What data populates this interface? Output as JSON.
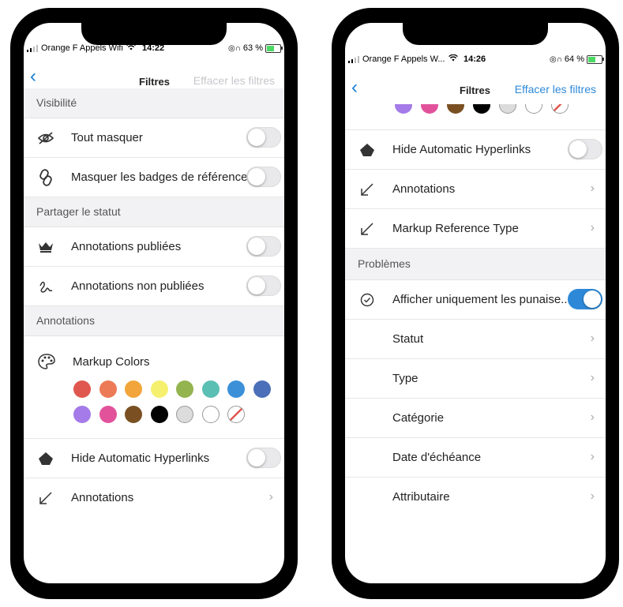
{
  "left": {
    "status": {
      "carrier": "Orange F Appels Wifi",
      "time": "14:22",
      "battery": "63 %"
    },
    "nav": {
      "back_icon": "chevron-left-icon",
      "title": "Filtres",
      "clear": "Effacer les filtres",
      "clear_color": "#c7c7cc"
    },
    "sections": {
      "visibility": "Visibilité",
      "share": "Partager le statut",
      "annotations": "Annotations"
    },
    "rows": {
      "hide_all": "Tout masquer",
      "hide_badges": "Masquer les badges de référence",
      "published": "Annotations publiées",
      "unpublished": "Annotations non publiées",
      "markup_colors": "Markup Colors",
      "hide_hyperlinks": "Hide Automatic Hyperlinks",
      "annotations": "Annotations"
    },
    "colors": [
      "#e0574f",
      "#ec7a57",
      "#f2a53a",
      "#f5f06e",
      "#93b44f",
      "#5bbfb3",
      "#3b90d8",
      "#4b6fb8",
      "#a47be8",
      "#e2529b",
      "#7a5022",
      "#000000",
      "#dcdcdc",
      "#ffffff",
      "none"
    ]
  },
  "right": {
    "status": {
      "carrier": "Orange F Appels W...",
      "time": "14:26",
      "battery": "64 %"
    },
    "nav": {
      "back_icon": "chevron-left-icon",
      "title": "Filtres",
      "clear": "Effacer les filtres",
      "clear_color": "#2d89d8"
    },
    "colors_partial": [
      "#a47be8",
      "#e2529b",
      "#7a5022",
      "#000000",
      "#dcdcdc",
      "#ffffff",
      "none"
    ],
    "rows": {
      "hide_hyperlinks": "Hide Automatic Hyperlinks",
      "annotations": "Annotations",
      "markup_ref": "Markup Reference Type",
      "problems_section": "Problèmes",
      "only_pins": "Afficher uniquement les punaise...",
      "status": "Statut",
      "type": "Type",
      "category": "Catégorie",
      "due_date": "Date d'échéance",
      "assignee": "Attributaire"
    }
  }
}
